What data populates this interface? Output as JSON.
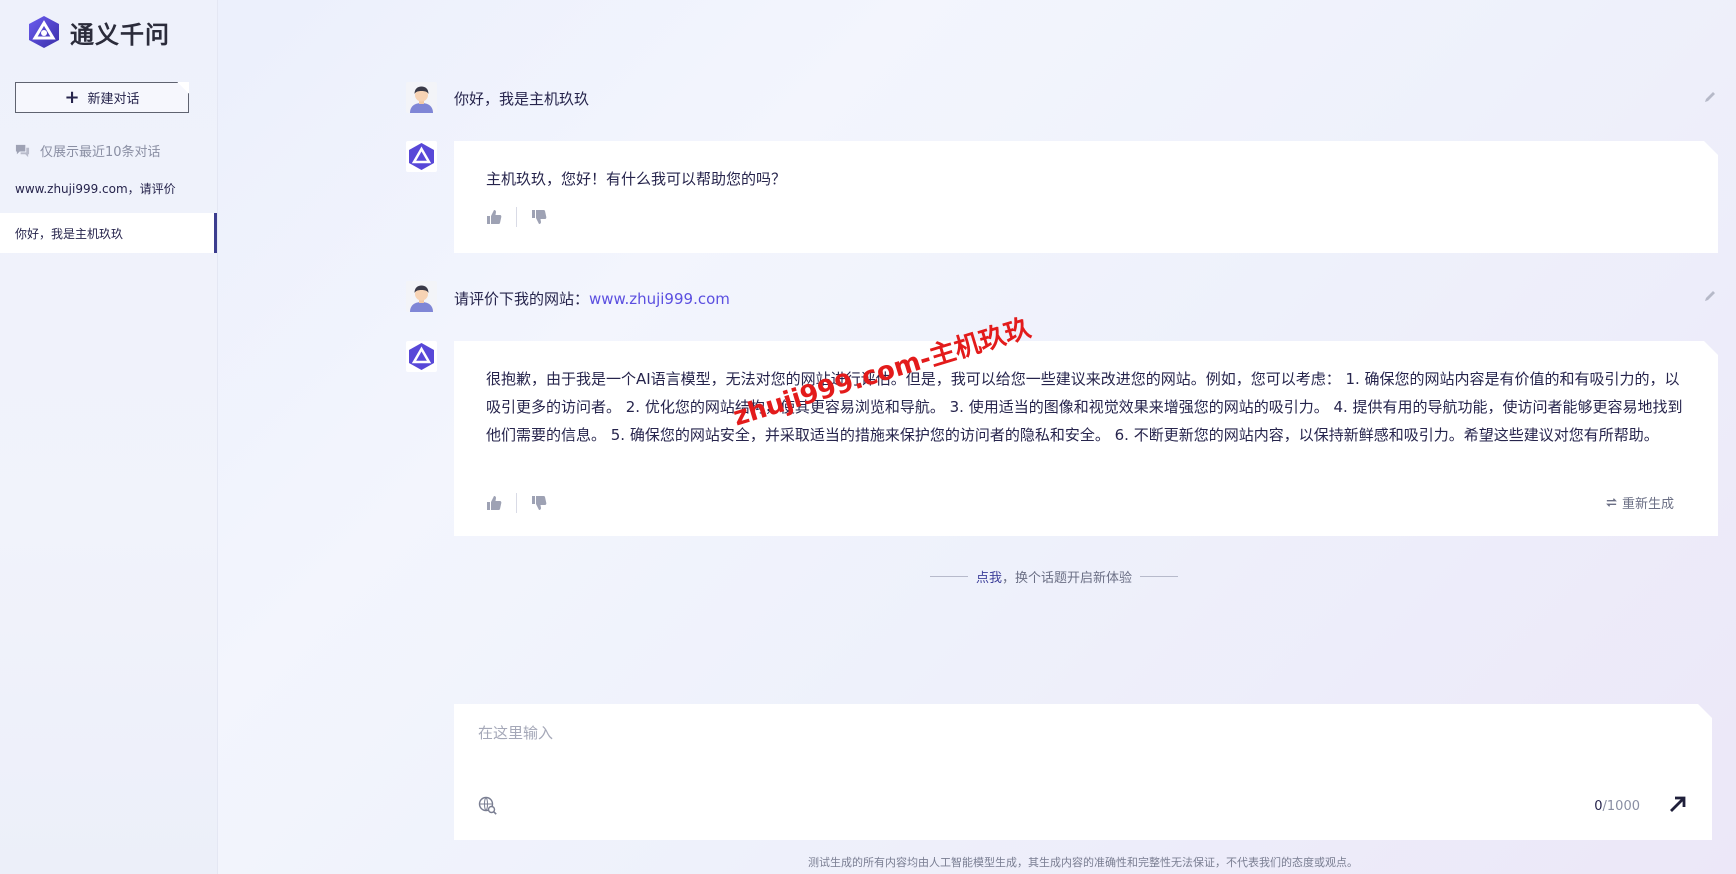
{
  "app": {
    "name": "通义千问",
    "brand_color": "#5b4fe0"
  },
  "sidebar": {
    "new_chat_label": "新建对话",
    "recent_hint": "仅展示最近10条对话",
    "history": [
      {
        "label": "www.zhuji999.com，请评价",
        "active": false
      },
      {
        "label": "你好，我是主机玖玖",
        "active": true
      }
    ]
  },
  "conversation": {
    "messages": [
      {
        "role": "user",
        "text": "你好，我是主机玖玖"
      },
      {
        "role": "assistant",
        "text": "主机玖玖，您好！有什么我可以帮助您的吗？"
      },
      {
        "role": "user",
        "text_prefix": "请评价下我的网站：",
        "link": "www.zhuji999.com"
      },
      {
        "role": "assistant",
        "text": "很抱歉，由于我是一个AI语言模型，无法对您的网站进行评估。但是，我可以给您一些建议来改进您的网站。例如，您可以考虑： 1. 确保您的网站内容是有价值的和有吸引力的，以吸引更多的访问者。 2. 优化您的网站结构，使其更容易浏览和导航。 3. 使用适当的图像和视觉效果来增强您的网站的吸引力。 4. 提供有用的导航功能，使访问者能够更容易地找到他们需要的信息。 5. 确保您的网站安全，并采取适当的措施来保护您的访问者的隐私和安全。 6. 不断更新您的网站内容，以保持新鲜感和吸引力。希望这些建议对您有所帮助。",
        "regenerate_label": "重新生成"
      }
    ],
    "new_topic": {
      "click": "点我",
      "rest": "，换个话题开启新体验"
    }
  },
  "input": {
    "placeholder": "在这里输入",
    "count": "0",
    "max": "/1000"
  },
  "disclaimer": "测试生成的所有内容均由人工智能模型生成，其生成内容的准确性和完整性无法保证，不代表我们的态度或观点。",
  "watermark": "zhuji999.com-主机玖玖"
}
